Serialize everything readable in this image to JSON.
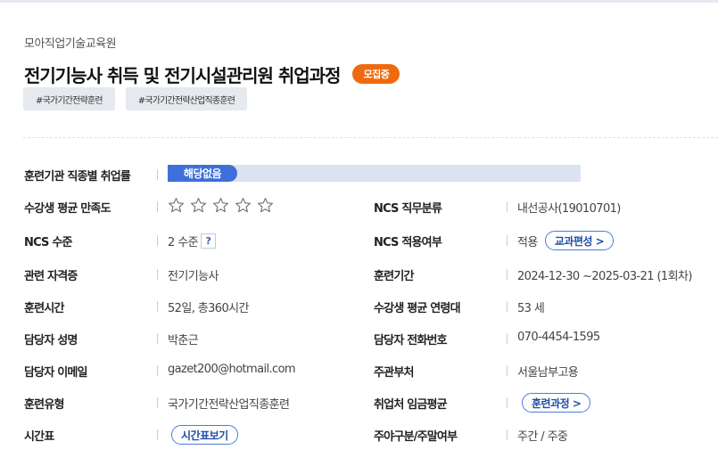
{
  "header": {
    "org": "모아직업기술교육원",
    "title": "전기기능사 취득 및 전기시설관리원 취업과정",
    "status_badge": "모집중",
    "tags": [
      "#국가기간전략훈련",
      "#국가기간전략산업직종훈련"
    ]
  },
  "employment_rate": {
    "label": "훈련기관 직종별 취업률",
    "value": "해당없음"
  },
  "satisfaction": {
    "label": "수강생 평균 만족도",
    "stars_filled": 0,
    "stars_total": 5
  },
  "fields": {
    "ncs_job": {
      "label": "NCS 직무분류",
      "value": "내선공사(19010701)"
    },
    "ncs_level": {
      "label": "NCS 수준",
      "value": "2 수준",
      "help": "?"
    },
    "ncs_apply": {
      "label": "NCS 적용여부",
      "value": "적용",
      "button": "교과편성 >"
    },
    "cert": {
      "label": "관련 자격증",
      "value": "전기기능사"
    },
    "period": {
      "label": "훈련기간",
      "value": "2024-12-30 ~2025-03-21 (1회차)"
    },
    "hours": {
      "label": "훈련시간",
      "value": "52일, 총360시간"
    },
    "age": {
      "label": "수강생 평균 연령대",
      "value": "53 세"
    },
    "manager_name": {
      "label": "담당자 성명",
      "value": "박춘근"
    },
    "manager_phone": {
      "label": "담당자 전화번호",
      "value": "070-4454-1595"
    },
    "manager_email": {
      "label": "담당자 이메일",
      "value": "gazet200@hotmail.com"
    },
    "dept": {
      "label": "주관부처",
      "value": "서울남부고용"
    },
    "type": {
      "label": "훈련유형",
      "value": "국가기간전략산업직종훈련"
    },
    "wage": {
      "label": "취업처 임금평균",
      "button": "훈련과정 >"
    },
    "timetable": {
      "label": "시간표",
      "button": "시간표보기"
    },
    "day_night": {
      "label": "주야구분/주말여부",
      "value": "주간 / 주중"
    }
  }
}
